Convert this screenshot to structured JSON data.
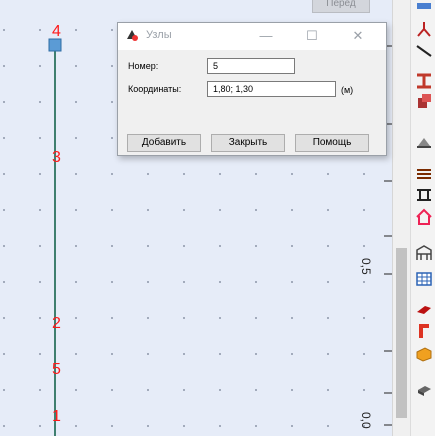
{
  "canvas": {
    "top_tab_label": "Перед",
    "node_labels": [
      "4",
      "3",
      "2",
      "5",
      "1"
    ],
    "axis_labels": [
      "0,5",
      "0,0"
    ],
    "colors": {
      "member": "#3f7f6f",
      "node_label": "#ff1a1a",
      "selected_node": "#5b9bd5"
    }
  },
  "dialog": {
    "title": "Узлы",
    "window_controls": {
      "minimize": "—",
      "maximize": "☐",
      "close": "✕"
    },
    "number_label": "Номер:",
    "number_value": "5",
    "coords_label": "Координаты:",
    "coords_value": "1,80; 1,30",
    "coords_unit": "(м)",
    "buttons": {
      "add": "Добавить",
      "close": "Закрыть",
      "help": "Помощь"
    }
  },
  "toolbar": {
    "icons": [
      "node-icon",
      "line-icon",
      "beam-icon",
      "member-icon",
      "support-icon",
      "load-icon",
      "section-icon",
      "home-icon",
      "structure-icon",
      "table-icon",
      "shape-icon",
      "profile-icon",
      "solid-icon",
      "plate-icon"
    ]
  }
}
